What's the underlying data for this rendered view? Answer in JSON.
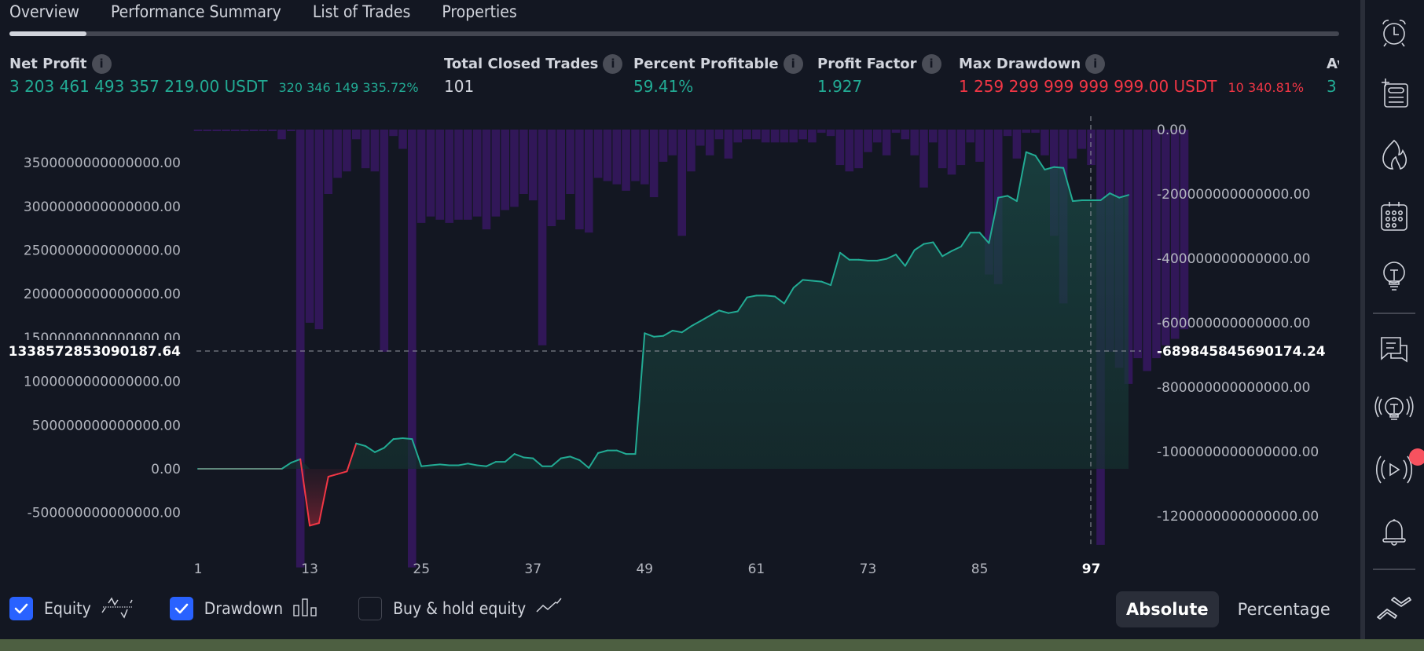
{
  "tabs": [
    {
      "label": "Overview",
      "active": true
    },
    {
      "label": "Performance Summary",
      "active": false
    },
    {
      "label": "List of Trades",
      "active": false
    },
    {
      "label": "Properties",
      "active": false
    }
  ],
  "metrics": [
    {
      "label": "Net Profit",
      "value": "3 203 461 493 357 219.00 USDT",
      "sub": "320 346 149 335.72%",
      "color": "#22ab94"
    },
    {
      "label": "Total Closed Trades",
      "value": "101",
      "sub": "",
      "color": "#d1d4dc"
    },
    {
      "label": "Percent Profitable",
      "value": "59.41%",
      "sub": "",
      "color": "#22ab94"
    },
    {
      "label": "Profit Factor",
      "value": "1.927",
      "sub": "",
      "color": "#22ab94"
    },
    {
      "label": "Max Drawdown",
      "value": "1 259 299 999 999 999.00 USDT",
      "sub": "10 340.81%",
      "color": "#f23645"
    },
    {
      "label": "Av",
      "value": "3",
      "sub": "",
      "color": "#22ab94"
    }
  ],
  "controls": {
    "equity": {
      "label": "Equity",
      "checked": true
    },
    "drawdown": {
      "label": "Drawdown",
      "checked": true
    },
    "buy_hold": {
      "label": "Buy & hold equity",
      "checked": false
    },
    "mode_absolute": "Absolute",
    "mode_percentage": "Percentage",
    "mode_selected": "Absolute"
  },
  "toolbar": {
    "icons": [
      "alarm-clock-icon",
      "add-watchlist-icon",
      "hotlist-flame-icon",
      "calendar-icon",
      "ideas-lightbulb-icon",
      "chat-icon",
      "streams-lightbulb-icon",
      "live-stream-icon",
      "notifications-bell-icon",
      "collapse-chevrons-icon"
    ],
    "badge_color": "#f7525f"
  },
  "colors": {
    "equity_line": "#22ab94",
    "equity_fill": "#163a3b",
    "negative_equity": "#f23645",
    "drawdown_bar": "#311758",
    "background": "#131722",
    "accent": "#2962ff"
  },
  "chart_data": {
    "type": "area+bar",
    "title": "",
    "x_ticks": [
      "1",
      "13",
      "25",
      "37",
      "49",
      "61",
      "73",
      "85",
      "97"
    ],
    "x_range": [
      1,
      101
    ],
    "crosshair": {
      "x_label": "97",
      "left_value": "1338572853090187.64",
      "right_value": "-689845845690174.24"
    },
    "left_axis": {
      "label": "Equity",
      "ticks": [
        "3500000000000000.00",
        "3000000000000000.00",
        "2500000000000000.00",
        "2000000000000000.00",
        "1500000000000000.00",
        "1000000000000000.00",
        "500000000000000.00",
        "0.00",
        "-500000000000000.00"
      ],
      "tick_values": [
        3500000000000000.0,
        3000000000000000.0,
        2500000000000000.0,
        2000000000000000.0,
        1500000000000000.0,
        1000000000000000.0,
        500000000000000.0,
        0,
        -500000000000000.0
      ],
      "range": [
        -800000000000000.0,
        3870000000000000.0
      ]
    },
    "right_axis": {
      "label": "Drawdown",
      "ticks": [
        "0.00",
        "-200000000000000.00",
        "-400000000000000.00",
        "-600000000000000.00",
        "-800000000000000.00",
        "-1000000000000000.00",
        "-1200000000000000.00"
      ],
      "tick_values": [
        0,
        -200000000000000.0,
        -400000000000000.0,
        -600000000000000.0,
        -800000000000000.0,
        -1000000000000000.0,
        -1200000000000000.0
      ],
      "range": [
        -1350000000000000.0,
        0.0
      ]
    },
    "series": [
      {
        "name": "Equity (×1e14)",
        "type": "line",
        "values": [
          0,
          0,
          0,
          0,
          0,
          0,
          0,
          0,
          0,
          0,
          0.7,
          1.1,
          -6.5,
          -6.2,
          -0.9,
          -0.6,
          -0.3,
          2.9,
          2.6,
          1.9,
          2.4,
          3.4,
          3.5,
          3.4,
          0.3,
          0.4,
          0.5,
          0.4,
          0.4,
          0.6,
          0.4,
          0.3,
          0.8,
          0.8,
          1.7,
          1.3,
          1.2,
          0.3,
          0.3,
          1.2,
          1.4,
          1.0,
          0.1,
          1.8,
          2.1,
          2.1,
          1.7,
          1.7,
          15.5,
          15.1,
          15.2,
          15.8,
          15.6,
          16.3,
          16.9,
          17.5,
          18.1,
          17.8,
          18.0,
          19.6,
          19.8,
          19.8,
          19.7,
          18.9,
          20.7,
          21.6,
          21.5,
          21.4,
          21.0,
          24.7,
          23.9,
          23.9,
          23.8,
          23.8,
          24.0,
          24.5,
          23.2,
          25.0,
          25.7,
          25.9,
          24.3,
          24.9,
          25.4,
          27.0,
          27.0,
          25.8,
          31.0,
          31.2,
          30.6,
          36.2,
          35.8,
          34.2,
          34.5,
          34.4,
          30.6,
          30.7,
          30.7,
          30.7,
          31.5,
          31.0,
          31.3
        ]
      },
      {
        "name": "Drawdown (×1e14)",
        "type": "bar",
        "values": [
          0,
          0,
          0,
          0,
          0,
          0,
          0,
          0,
          0,
          -0.3,
          0,
          -13.6,
          -6.0,
          -6.2,
          -2.0,
          -1.5,
          -1.3,
          -0.3,
          -1.2,
          -1.3,
          -6.9,
          -0.2,
          -0.6,
          -13.6,
          -2.9,
          -2.7,
          -2.8,
          -2.9,
          -2.8,
          -2.8,
          -2.7,
          -3.1,
          -2.7,
          -2.5,
          -2.4,
          -2.0,
          -2.2,
          -6.7,
          -3.0,
          -2.8,
          -2.0,
          -3.1,
          -3.2,
          -1.5,
          -1.6,
          -1.7,
          -1.9,
          -1.6,
          -1.7,
          -2.1,
          -1.0,
          -0.8,
          -3.3,
          -1.3,
          -0.5,
          -0.8,
          -0.3,
          -0.9,
          -0.4,
          -0.3,
          -0.3,
          -0.4,
          -0.4,
          -0.4,
          -0.4,
          -0.3,
          -0.4,
          -0.1,
          -0.2,
          -1.1,
          -1.3,
          -1.2,
          -0.7,
          -0.4,
          -0.8,
          -0.1,
          -0.3,
          -0.8,
          -1.8,
          -0.4,
          -1.2,
          -1.4,
          -1.1,
          -0.4,
          -1.0,
          -4.5,
          -4.8,
          -0.2,
          -0.9,
          -0.1,
          -0.1,
          -0.8,
          -3.3,
          -5.4,
          -0.9,
          -0.6,
          -1.1,
          -12.9,
          -6.9,
          -7.4,
          -7.9,
          -7.1,
          -7.5,
          -7.1,
          -6.7,
          -6.5,
          -6.2
        ]
      }
    ],
    "legend": [
      "Equity",
      "Drawdown",
      "Buy & hold equity"
    ],
    "grid": false
  }
}
